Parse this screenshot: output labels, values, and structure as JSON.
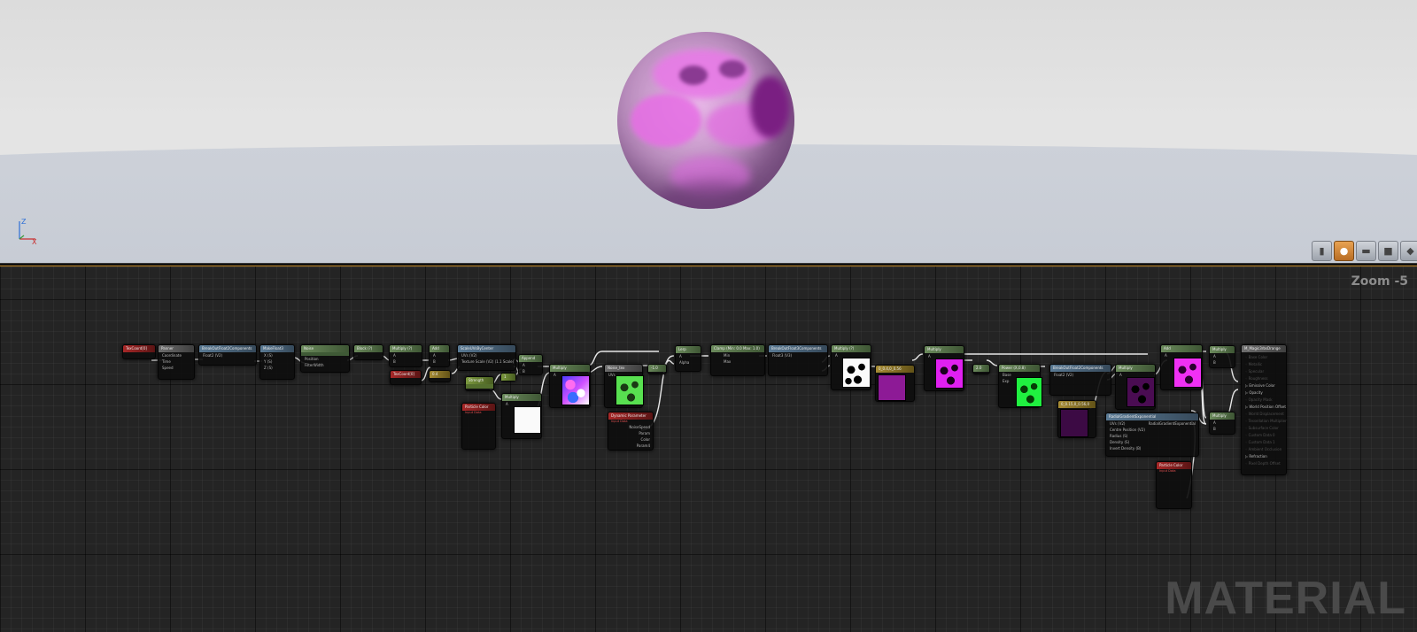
{
  "viewport": {
    "axis": {
      "z_label": "Z",
      "x_label": "X"
    },
    "toolbar": [
      {
        "name": "cylinder-preview-button",
        "glyph": "▮",
        "active": false
      },
      {
        "name": "sphere-preview-button",
        "glyph": "●",
        "active": true
      },
      {
        "name": "plane-preview-button",
        "glyph": "▬",
        "active": false
      },
      {
        "name": "cube-preview-button",
        "glyph": "■",
        "active": false
      },
      {
        "name": "custom-mesh-preview-button",
        "glyph": "◆",
        "active": false
      }
    ]
  },
  "graph": {
    "zoom_label": "Zoom -5",
    "watermark": "MATERIAL"
  },
  "nodes": {
    "texcoord1": {
      "title": "TexCoord[0]"
    },
    "panner": {
      "title": "Panner",
      "pins": [
        "Coordinate",
        "Time",
        "Speed"
      ]
    },
    "break_float2_a": {
      "title": "BreakOutFloat2Components",
      "pin": "Float2 (V2)",
      "out_r": "R",
      "out_g": "G"
    },
    "make_float3": {
      "title": "MakeFloat3",
      "pins": [
        "X (S)",
        "Y (S)",
        "Z (S)"
      ],
      "out": "Result"
    },
    "noise": {
      "title": "Noise",
      "pins": [
        "Position",
        "FilterWidth"
      ]
    },
    "block": {
      "title": "Block (?)"
    },
    "multiply_1": {
      "title": "Multiply (?)",
      "pins": [
        "A",
        "B"
      ]
    },
    "add_1": {
      "title": "Add",
      "pins": [
        "A",
        "B"
      ]
    },
    "texcoord2": {
      "title": "TexCoord[0]"
    },
    "const_04": {
      "title": "0.4"
    },
    "scale_uv": {
      "title": "ScaleUVsByCenter",
      "pins": [
        "UVs (V2)",
        "Texture Scale (V2) (1.1 Scale)"
      ],
      "outs": [
        "UVs",
        "Scale"
      ]
    },
    "append": {
      "title": "Append",
      "pins": [
        "A",
        "B"
      ]
    },
    "strength": {
      "title": "Strength"
    },
    "const_1": {
      "title": "1"
    },
    "multiply_2": {
      "title": "Multiply",
      "pins": [
        "A",
        "B"
      ]
    },
    "particle_color_1": {
      "title": "Particle Color",
      "subtitle": "Input Data"
    },
    "multiply_3": {
      "title": "Multiply",
      "pins": [
        "A",
        "B"
      ]
    },
    "noise_tex": {
      "title": "Noise_tex",
      "pins": [
        "UVs",
        "Tex"
      ]
    },
    "const_n1": {
      "title": "-1.0"
    },
    "dynamic_param": {
      "title": "Dynamic Parameter",
      "subtitle": "Input Data",
      "outs": [
        "NoiseSpeed",
        "Param",
        "Color",
        "Param4"
      ]
    },
    "lerp": {
      "title": "Lerp",
      "pins": [
        "A",
        "B",
        "Alpha"
      ]
    },
    "clamp": {
      "title": "Clamp (Min: 0.0 Max: 1.0)",
      "pins": [
        "Min",
        "Max"
      ]
    },
    "break_float3": {
      "title": "BreakOutFloat3Components",
      "pin": "Float3 (V3)",
      "outs": [
        "R",
        "G",
        "B"
      ]
    },
    "multiply_4": {
      "title": "Multiply (?)",
      "pins": [
        "A",
        "B"
      ]
    },
    "color_purple_1": {
      "title": "0_0.4,0_0.56"
    },
    "multiply_5": {
      "title": "Multiply",
      "pins": [
        "A",
        "B"
      ]
    },
    "const_2": {
      "title": "2.0"
    },
    "power": {
      "title": "Power (X,0.8)",
      "pins": [
        "Base",
        "Exp"
      ]
    },
    "break_float2_b": {
      "title": "BreakOutFloat2Components",
      "pin": "Float2 (V2)",
      "outs": [
        "R",
        "G",
        "B"
      ]
    },
    "multiply_6": {
      "title": "Multiply",
      "pins": [
        "A",
        "B"
      ]
    },
    "color_purple_2": {
      "title": "0_0.15,0_0.56,0"
    },
    "radial_gradient": {
      "title": "RadialGradientExponential",
      "pins": [
        "UVs (V2)",
        "Centre Position (V2)",
        "Radius (S)",
        "Density (S)",
        "Invert Density (B)"
      ],
      "out": "RadialGradientExponential"
    },
    "add_2": {
      "title": "Add",
      "pins": [
        "A",
        "B"
      ]
    },
    "multiply_7": {
      "title": "Multiply",
      "pins": [
        "A",
        "B"
      ]
    },
    "multiply_8": {
      "title": "Multiply",
      "pins": [
        "A",
        "B"
      ]
    },
    "particle_color_2": {
      "title": "Particle Color",
      "subtitle": "Input Data"
    },
    "output": {
      "title": "M_Magic3rbsDrange",
      "pins": [
        {
          "label": "Base Color",
          "active": false
        },
        {
          "label": "Metallic",
          "active": false
        },
        {
          "label": "Specular",
          "active": false
        },
        {
          "label": "Roughness",
          "active": false
        },
        {
          "label": "Emissive Color",
          "active": true
        },
        {
          "label": "Opacity",
          "active": true
        },
        {
          "label": "Opacity Mask",
          "active": false
        },
        {
          "label": "World Position Offset",
          "active": true
        },
        {
          "label": "World Displacement",
          "active": false
        },
        {
          "label": "Tessellation Multiplier",
          "active": false
        },
        {
          "label": "Subsurface Color",
          "active": false
        },
        {
          "label": "Custom Data 0",
          "active": false
        },
        {
          "label": "Custom Data 1",
          "active": false
        },
        {
          "label": "Ambient Occlusion",
          "active": false
        },
        {
          "label": "Refraction",
          "active": true
        },
        {
          "label": "Pixel Depth Offset",
          "active": false
        }
      ]
    }
  }
}
